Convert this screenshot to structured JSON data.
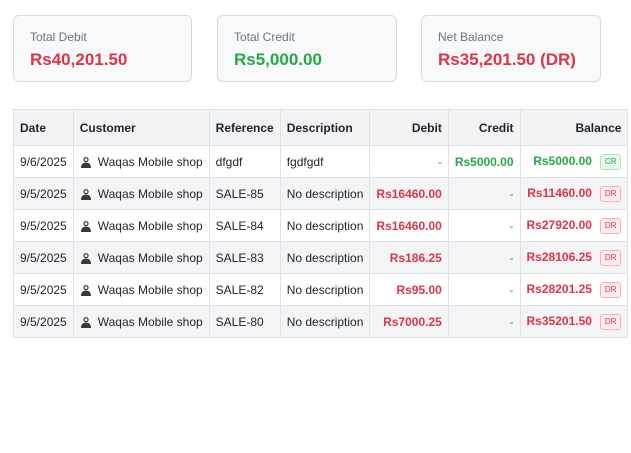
{
  "summary": {
    "total_debit_label": "Total Debit",
    "total_debit_value": "Rs40,201.50",
    "total_credit_label": "Total Credit",
    "total_credit_value": "Rs5,000.00",
    "net_balance_label": "Net Balance",
    "net_balance_value": "Rs35,201.50 (DR)"
  },
  "table": {
    "headers": {
      "date": "Date",
      "customer": "Customer",
      "reference": "Reference",
      "description": "Description",
      "debit": "Debit",
      "credit": "Credit",
      "balance": "Balance"
    },
    "rows": [
      {
        "date": "9/6/2025",
        "customer": "Waqas Mobile shop",
        "reference": "dfgdf",
        "description": "fgdfgdf",
        "debit": "-",
        "credit": "Rs5000.00",
        "balance": "Rs5000.00",
        "badge": "CR"
      },
      {
        "date": "9/5/2025",
        "customer": "Waqas Mobile shop",
        "reference": "SALE-85",
        "description": "No description",
        "debit": "Rs16460.00",
        "credit": "-",
        "balance": "Rs11460.00",
        "badge": "DR"
      },
      {
        "date": "9/5/2025",
        "customer": "Waqas Mobile shop",
        "reference": "SALE-84",
        "description": "No description",
        "debit": "Rs16460.00",
        "credit": "-",
        "balance": "Rs27920.00",
        "badge": "DR"
      },
      {
        "date": "9/5/2025",
        "customer": "Waqas Mobile shop",
        "reference": "SALE-83",
        "description": "No description",
        "debit": "Rs186.25",
        "credit": "-",
        "balance": "Rs28106.25",
        "badge": "DR"
      },
      {
        "date": "9/5/2025",
        "customer": "Waqas Mobile shop",
        "reference": "SALE-82",
        "description": "No description",
        "debit": "Rs95.00",
        "credit": "-",
        "balance": "Rs28201.25",
        "badge": "DR"
      },
      {
        "date": "9/5/2025",
        "customer": "Waqas Mobile shop",
        "reference": "SALE-80",
        "description": "No description",
        "debit": "Rs7000.25",
        "credit": "-",
        "balance": "Rs35201.50",
        "badge": "DR"
      }
    ]
  },
  "icons": {
    "customer": "person-icon"
  },
  "colors": {
    "debit": "#dc3545",
    "credit": "#28a745"
  }
}
